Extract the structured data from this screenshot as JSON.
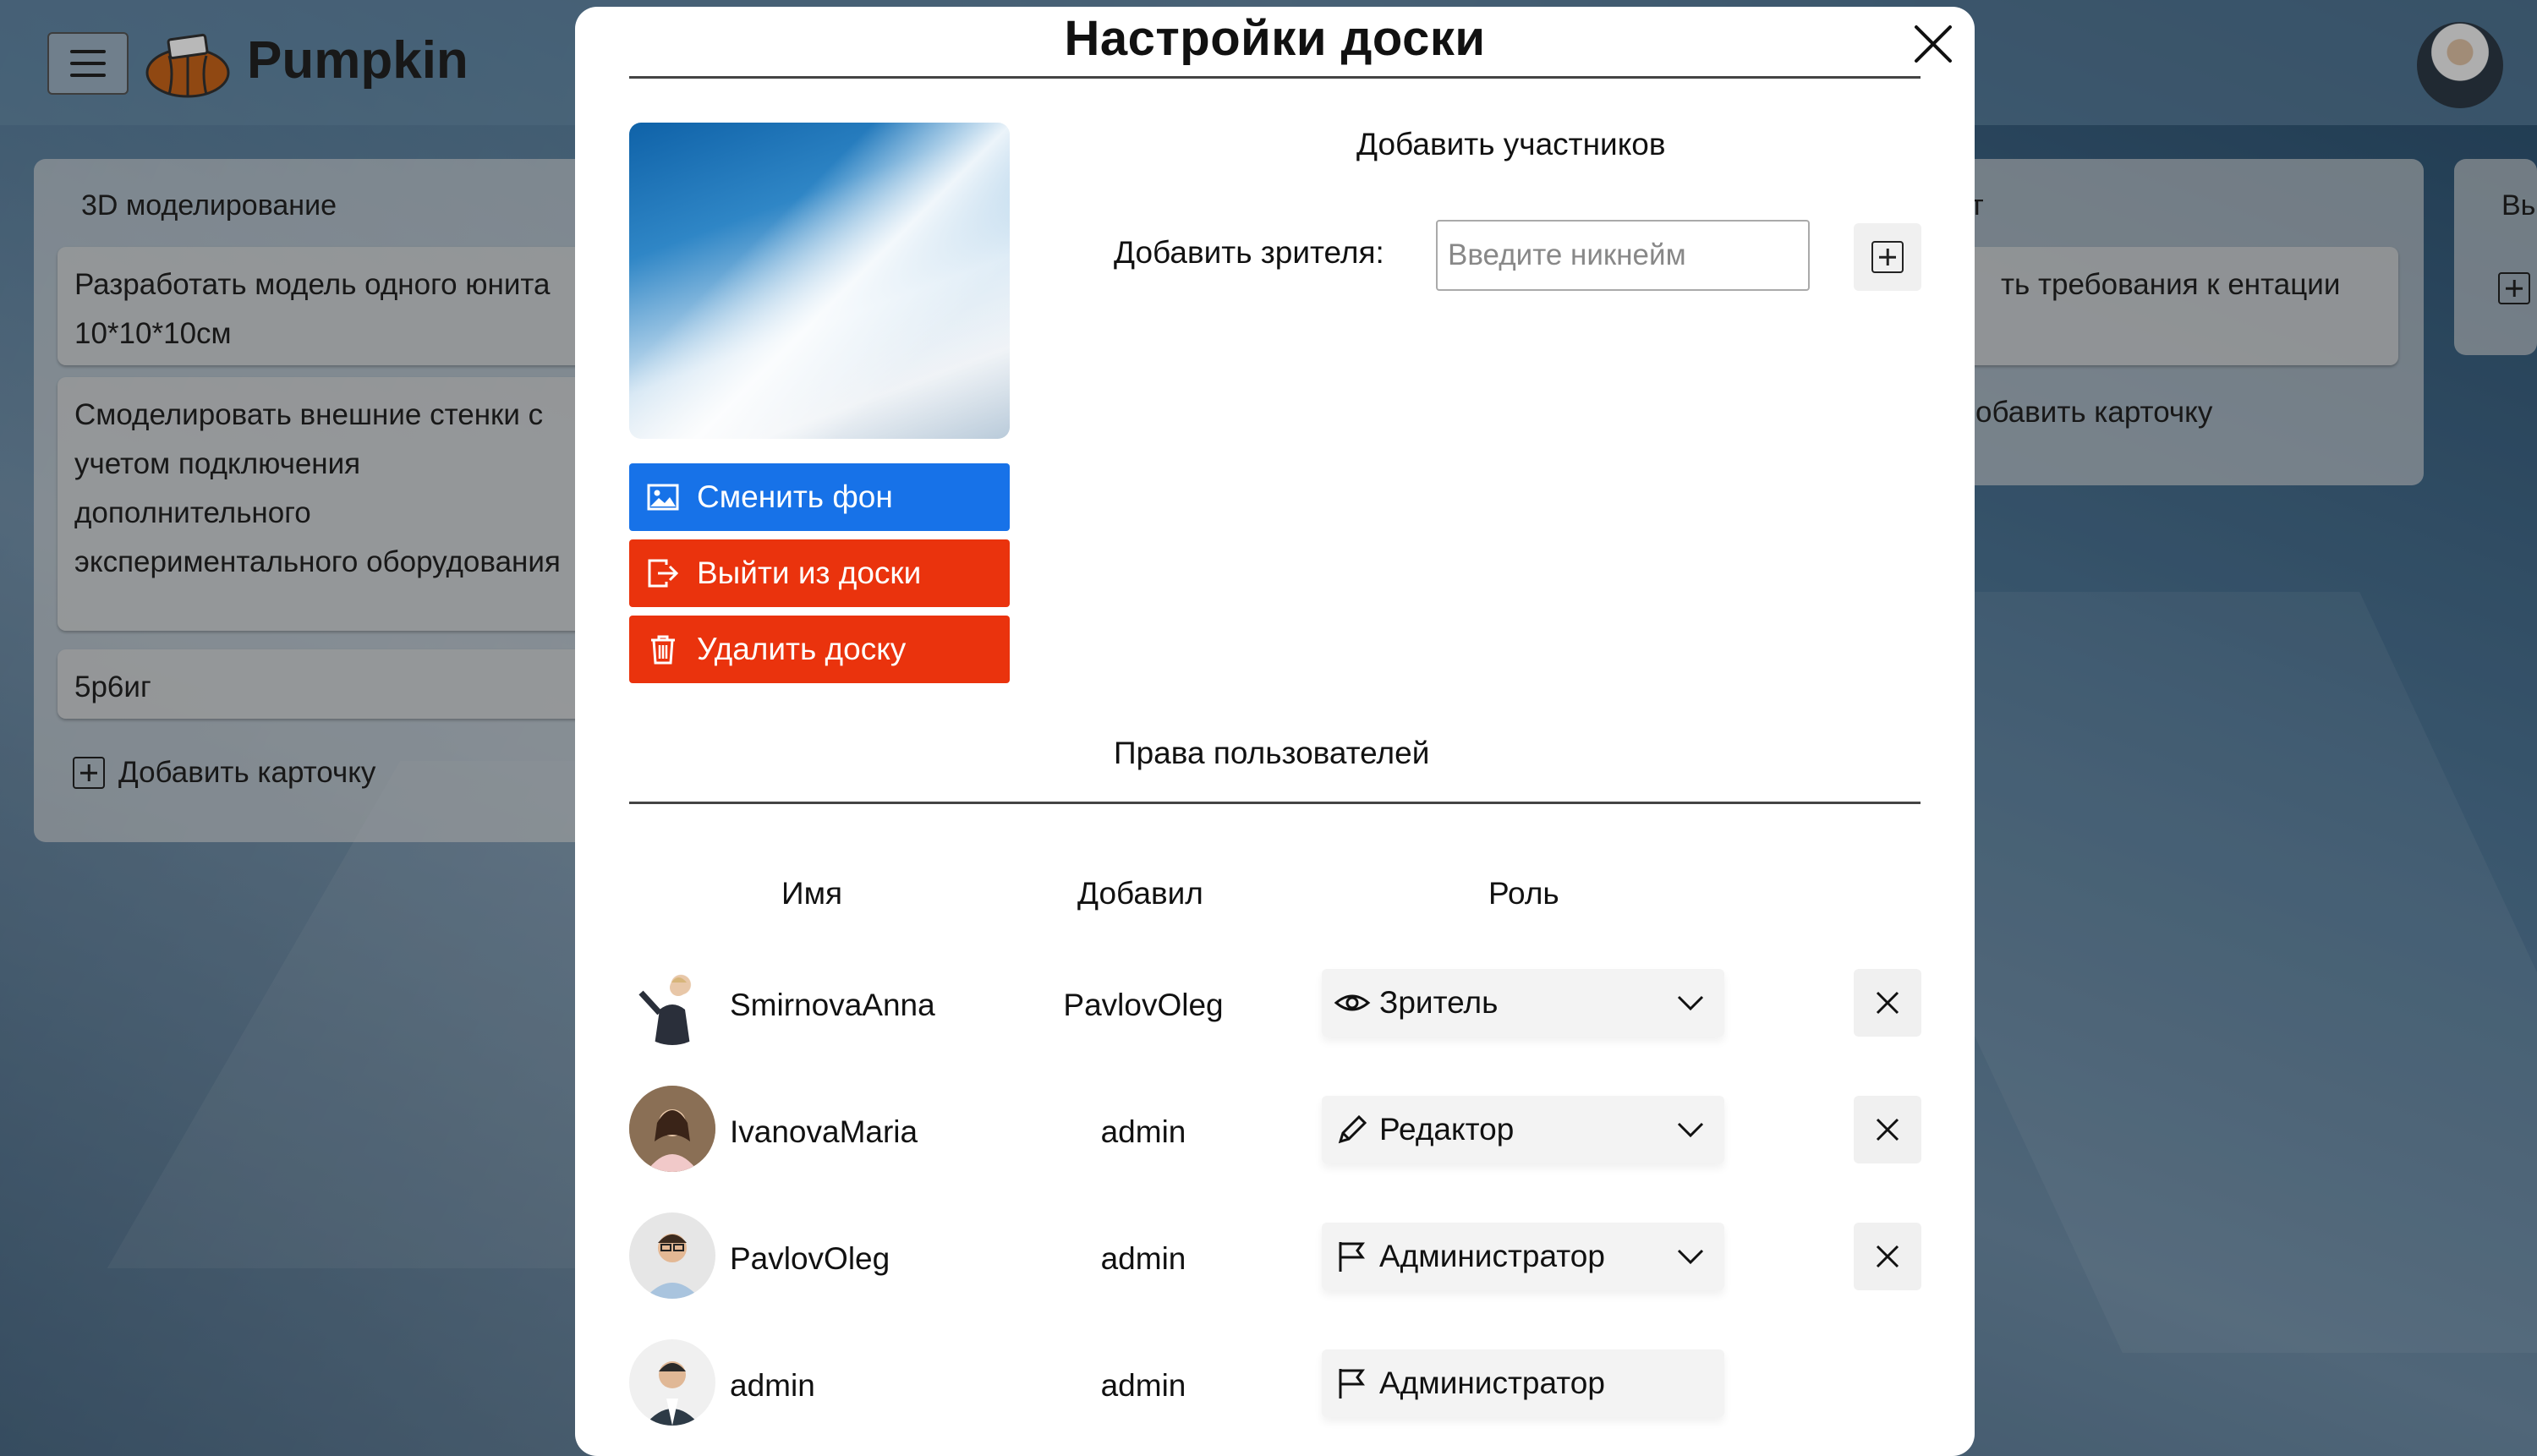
{
  "app": {
    "name": "Pumpkin"
  },
  "board_columns": [
    {
      "title": "3D моделирование",
      "cards": [
        "Разработать модель одного юнита 10*10*10см",
        "Смоделировать внешние стенки с учетом подключения дополнительного экспериментального оборудования",
        "5p6иг"
      ],
      "add_card_label": "Добавить карточку"
    },
    {
      "title": "т",
      "cards": [
        "ть требования к ентации"
      ],
      "add_card_label": "обавить карточку"
    },
    {
      "title": "Вь"
    }
  ],
  "modal": {
    "title": "Настройки доски",
    "buttons": {
      "change_bg": "Сменить фон",
      "leave_board": "Выйти из доски",
      "delete_board": "Удалить доску"
    },
    "add_members_heading": "Добавить участников",
    "add_viewer_label": "Добавить зрителя:",
    "nickname_placeholder": "Введите никнейм",
    "rights_heading": "Права пользователей",
    "columns": {
      "name": "Имя",
      "added_by": "Добавил",
      "role": "Роль"
    },
    "users": [
      {
        "name": "SmirnovaAnna",
        "added_by": "PavlovOleg",
        "role": "Зритель",
        "role_icon": "eye-icon",
        "removable": true,
        "editable": true
      },
      {
        "name": "IvanovaMaria",
        "added_by": "admin",
        "role": "Редактор",
        "role_icon": "pencil-icon",
        "removable": true,
        "editable": true
      },
      {
        "name": "PavlovOleg",
        "added_by": "admin",
        "role": "Администратор",
        "role_icon": "flag-icon",
        "removable": true,
        "editable": true
      },
      {
        "name": "admin",
        "added_by": "admin",
        "role": "Администратор",
        "role_icon": "flag-icon",
        "removable": false,
        "editable": false
      }
    ]
  },
  "colors": {
    "primary_blue": "#1772e8",
    "danger_red": "#ea330d"
  }
}
